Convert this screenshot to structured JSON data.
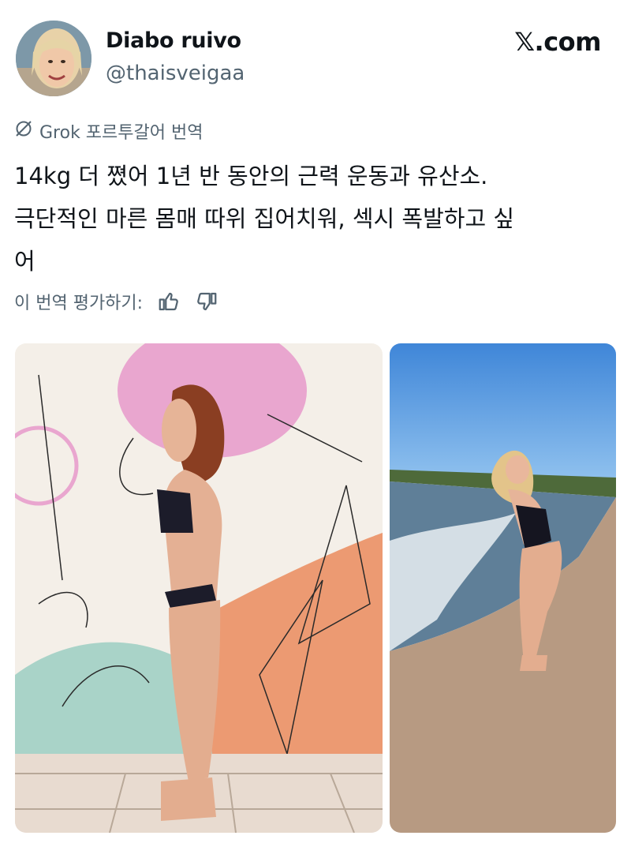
{
  "author": {
    "display_name": "Diabo ruivo",
    "handle": "@thaisveigaa"
  },
  "brand": {
    "label": "𝕏.com"
  },
  "translation": {
    "icon": "grok-icon",
    "label": "Grok 포르투갈어 번역"
  },
  "tweet": {
    "lines": [
      "14kg 더 쪘어 1년 반 동안의 근력 운동과 유산소.",
      "극단적인 마른 몸매 따위 집어치워, 섹시 폭발하고 싶",
      "어"
    ]
  },
  "rating": {
    "label": "이 번역 평가하기:",
    "thumbs_up_icon": "thumbs-up-icon",
    "thumbs_down_icon": "thumbs-down-icon"
  },
  "colors": {
    "text_primary": "#0f1419",
    "text_secondary": "#536471",
    "wall_pink": "#e9a6cf",
    "wall_peach": "#ec9a72",
    "wall_mint": "#a9d3c8",
    "sky": "#5d9be0",
    "sea": "#5f7f98",
    "sand": "#b79a82"
  }
}
